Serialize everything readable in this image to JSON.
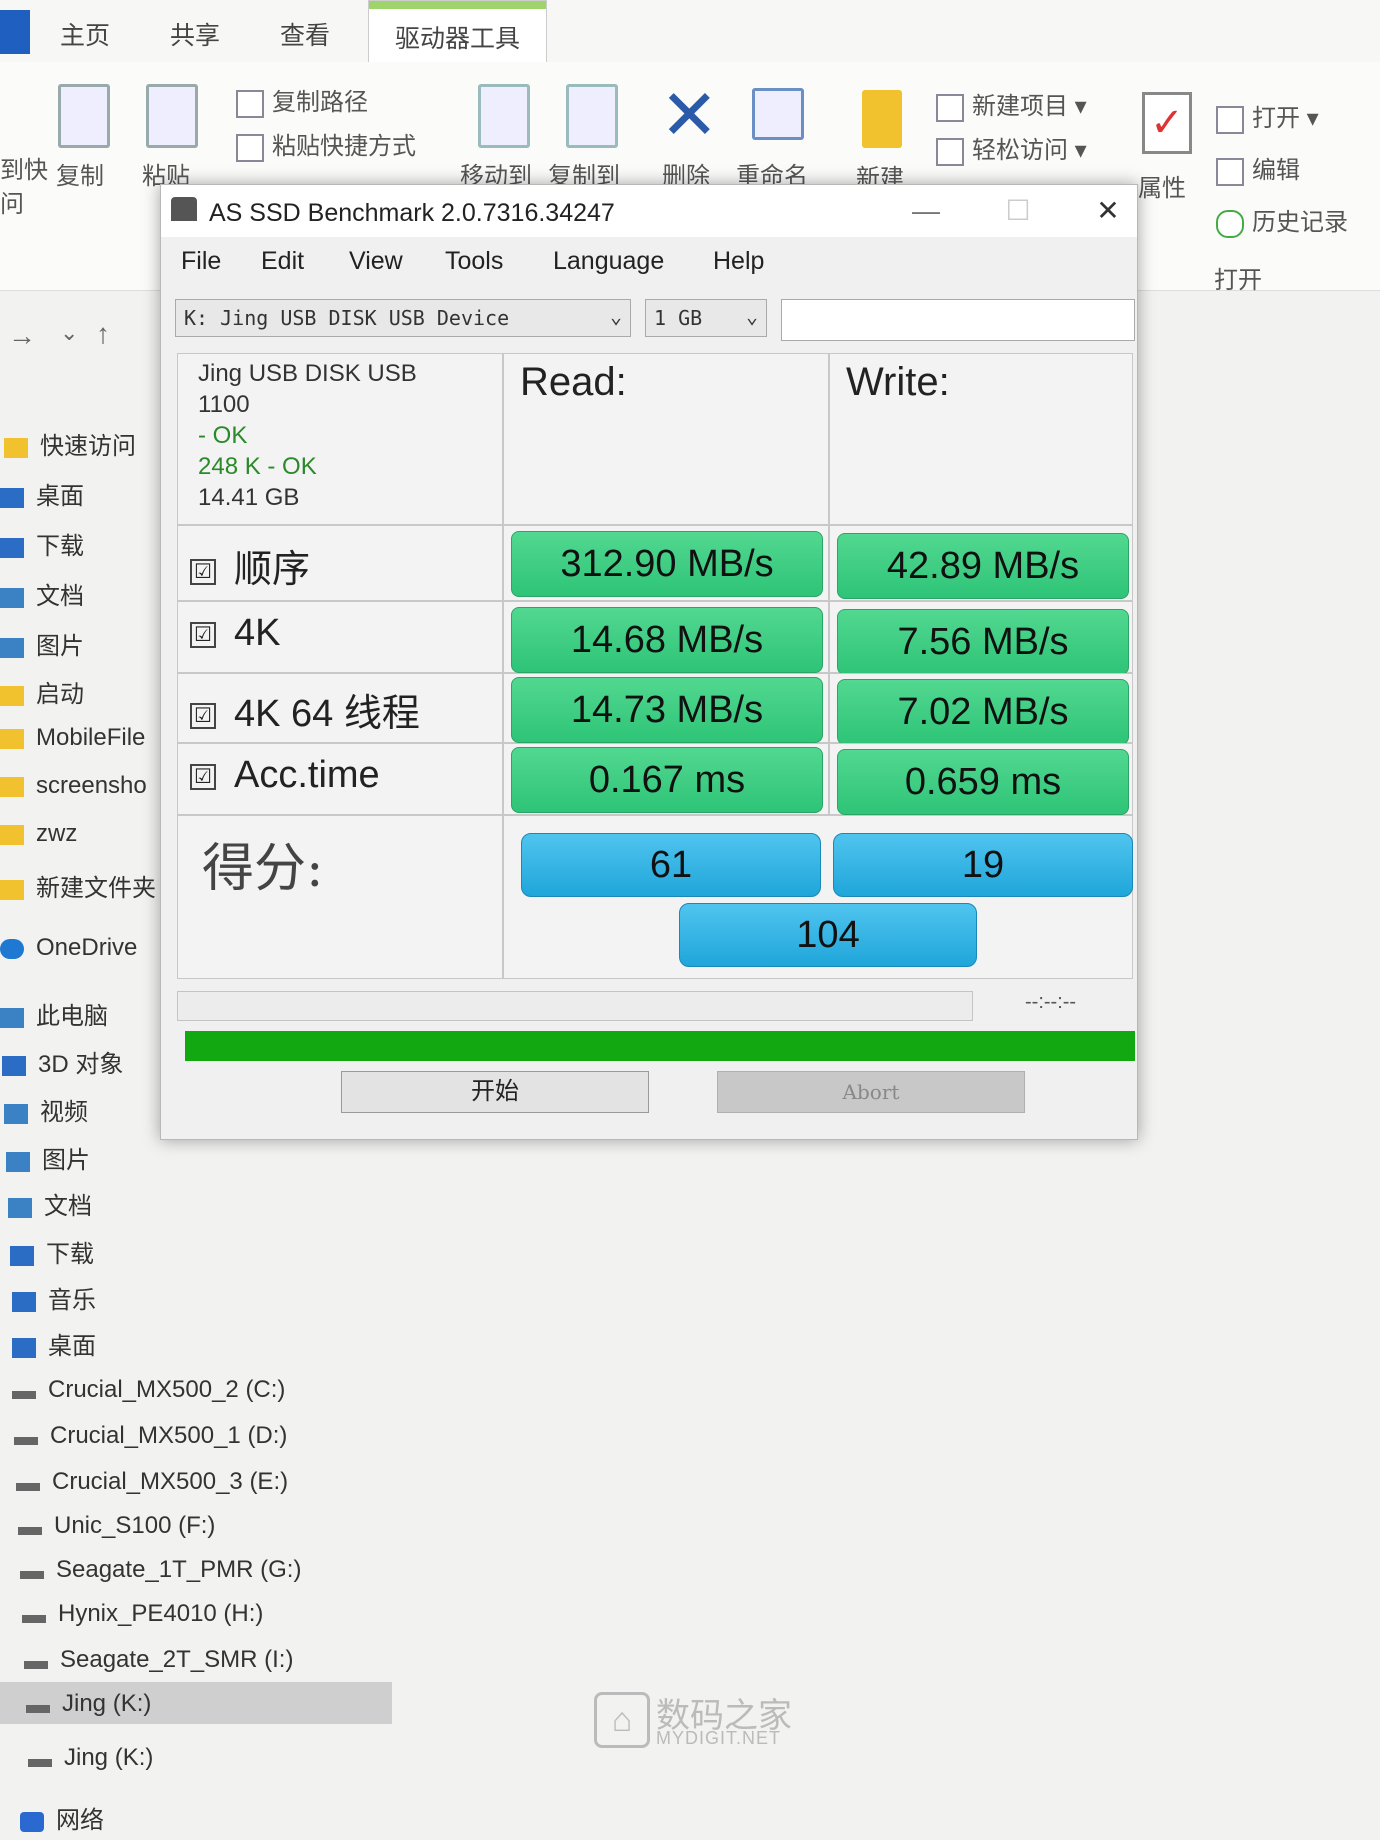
{
  "explorer": {
    "tabs": [
      "主页",
      "共享",
      "查看",
      "驱动器工具"
    ],
    "ribbon": {
      "pin_label": "到快\n问",
      "copy": "复制",
      "paste": "粘贴",
      "copy_path": "复制路径",
      "paste_shortcut": "粘贴快捷方式",
      "move_to": "移动到",
      "copy_to": "复制到",
      "delete": "删除",
      "rename": "重命名",
      "new_folder": "新建",
      "new_item": "新建项目",
      "easy_access": "轻松访问",
      "properties": "属性",
      "open": "打开",
      "edit": "编辑",
      "history": "历史记录",
      "open_group": "打开"
    },
    "sidebar": [
      {
        "label": "快速访问",
        "icon": "star-icon"
      },
      {
        "label": "桌面",
        "icon": "desktop-icon"
      },
      {
        "label": "下载",
        "icon": "download-icon"
      },
      {
        "label": "文档",
        "icon": "document-icon"
      },
      {
        "label": "图片",
        "icon": "picture-icon"
      },
      {
        "label": "启动",
        "icon": "folder-icon"
      },
      {
        "label": "MobileFile",
        "icon": "folder-icon"
      },
      {
        "label": "screensho",
        "icon": "folder-icon"
      },
      {
        "label": "zwz",
        "icon": "folder-icon"
      },
      {
        "label": "新建文件夹",
        "icon": "folder-icon"
      },
      {
        "label": "OneDrive",
        "icon": "cloud-icon"
      },
      {
        "label": "此电脑",
        "icon": "pc-icon"
      },
      {
        "label": "3D 对象",
        "icon": "cube-icon"
      },
      {
        "label": "视频",
        "icon": "video-icon"
      },
      {
        "label": "图片",
        "icon": "picture-icon"
      },
      {
        "label": "文档",
        "icon": "document-icon"
      },
      {
        "label": "下载",
        "icon": "download-icon"
      },
      {
        "label": "音乐",
        "icon": "music-icon"
      },
      {
        "label": "桌面",
        "icon": "desktop-icon"
      },
      {
        "label": "Crucial_MX500_2 (C:)",
        "icon": "drive-icon"
      },
      {
        "label": "Crucial_MX500_1 (D:)",
        "icon": "drive-icon"
      },
      {
        "label": "Crucial_MX500_3 (E:)",
        "icon": "drive-icon"
      },
      {
        "label": "Unic_S100 (F:)",
        "icon": "drive-icon"
      },
      {
        "label": "Seagate_1T_PMR (G:)",
        "icon": "drive-icon"
      },
      {
        "label": "Hynix_PE4010 (H:)",
        "icon": "drive-icon"
      },
      {
        "label": "Seagate_2T_SMR (I:)",
        "icon": "drive-icon"
      },
      {
        "label": "Jing (K:)",
        "icon": "drive-icon"
      },
      {
        "label": "Jing (K:)",
        "icon": "drive-icon"
      },
      {
        "label": "网络",
        "icon": "network-icon"
      }
    ]
  },
  "app": {
    "title": "AS SSD Benchmark 2.0.7316.34247",
    "menu": [
      "File",
      "Edit",
      "View",
      "Tools",
      "Language",
      "Help"
    ],
    "drive_select": "K: Jing USB DISK USB Device",
    "size_select": "1 GB",
    "device_info": {
      "name": "Jing USB DISK USB",
      "firmware": "1100",
      "driver_status": "- OK",
      "alignment": "248 K - OK",
      "capacity": "14.41 GB"
    },
    "read_header": "Read:",
    "write_header": "Write:",
    "checkbox_mark": "☑",
    "rows": [
      {
        "label": "顺序",
        "read": "312.90 MB/s",
        "write": "42.89 MB/s"
      },
      {
        "label": "4K",
        "read": "14.68 MB/s",
        "write": "7.56 MB/s"
      },
      {
        "label": "4K 64 线程",
        "read": "14.73 MB/s",
        "write": "7.02 MB/s"
      },
      {
        "label": "Acc.time",
        "read": "0.167 ms",
        "write": "0.659 ms"
      }
    ],
    "score_label": "得分:",
    "score_read": "61",
    "score_write": "19",
    "score_total": "104",
    "time_display": "--:--:--",
    "start_button": "开始",
    "abort_button": "Abort",
    "colors": {
      "result_green": "#2ec477",
      "score_blue": "#1fa6da",
      "progress_green": "#12a812"
    }
  },
  "watermark": {
    "cn": "数码之家",
    "en": "MYDIGIT.NET"
  }
}
